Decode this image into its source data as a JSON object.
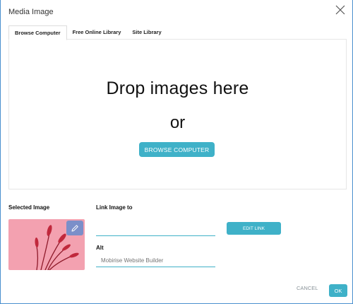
{
  "dialog": {
    "title": "Media Image",
    "close_icon": "close-icon"
  },
  "tabs": [
    {
      "label": "Browse Computer",
      "active": true
    },
    {
      "label": "Free Online Library",
      "active": false
    },
    {
      "label": "Site Library",
      "active": false
    }
  ],
  "dropzone": {
    "title": "Drop images here",
    "or_text": "or",
    "browse_label": "BROWSE COMPUTER"
  },
  "selected_image": {
    "label": "Selected Image",
    "edit_icon": "pencil-icon"
  },
  "link": {
    "label": "Link Image to",
    "value": "",
    "edit_label": "EDIT LINK"
  },
  "alt": {
    "label": "Alt",
    "placeholder": "Mobirise Website Builder"
  },
  "footer": {
    "cancel_label": "CANCEL",
    "ok_label": "OK"
  },
  "colors": {
    "accent": "#3fb1c8",
    "thumbnail_bg": "#f3a1b0",
    "edit_button": "#7b8fc9"
  }
}
